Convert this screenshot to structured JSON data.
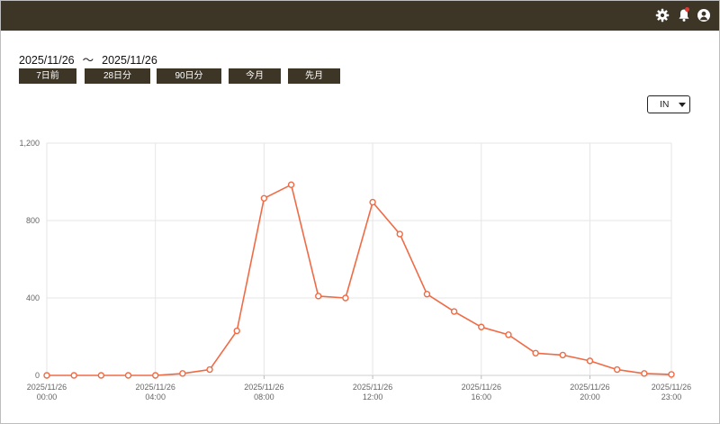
{
  "header": {
    "icons": [
      "gear-icon",
      "bell-icon",
      "user-icon"
    ],
    "notification_color": "#e53935",
    "bar_color": "#3d3627"
  },
  "date_range": {
    "start": "2025/11/26",
    "separator": "〜",
    "end": "2025/11/26"
  },
  "range_buttons": [
    {
      "label": "7日前"
    },
    {
      "label": "28日分"
    },
    {
      "label": "90日分"
    },
    {
      "label": "今月"
    },
    {
      "label": "先月"
    }
  ],
  "direction_select": {
    "value": "IN"
  },
  "chart_data": {
    "type": "line",
    "color": "#f06b45",
    "ylim": [
      0,
      1200
    ],
    "y_ticks": [
      "0",
      "400",
      "800",
      "1,200"
    ],
    "x_ticks": [
      {
        "hour": 0,
        "date": "2025/11/26",
        "time": "00:00"
      },
      {
        "hour": 4,
        "date": "2025/11/26",
        "time": "04:00"
      },
      {
        "hour": 8,
        "date": "2025/11/26",
        "time": "08:00"
      },
      {
        "hour": 12,
        "date": "2025/11/26",
        "time": "12:00"
      },
      {
        "hour": 16,
        "date": "2025/11/26",
        "time": "16:00"
      },
      {
        "hour": 20,
        "date": "2025/11/26",
        "time": "20:00"
      },
      {
        "hour": 23,
        "date": "2025/11/26",
        "time": "23:00"
      }
    ],
    "x": [
      0,
      1,
      2,
      3,
      4,
      5,
      6,
      7,
      8,
      9,
      10,
      11,
      12,
      13,
      14,
      15,
      16,
      17,
      18,
      19,
      20,
      21,
      22,
      23
    ],
    "values": [
      0,
      0,
      0,
      0,
      0,
      10,
      30,
      230,
      915,
      985,
      410,
      400,
      895,
      730,
      420,
      330,
      250,
      210,
      115,
      105,
      75,
      30,
      10,
      5
    ]
  }
}
